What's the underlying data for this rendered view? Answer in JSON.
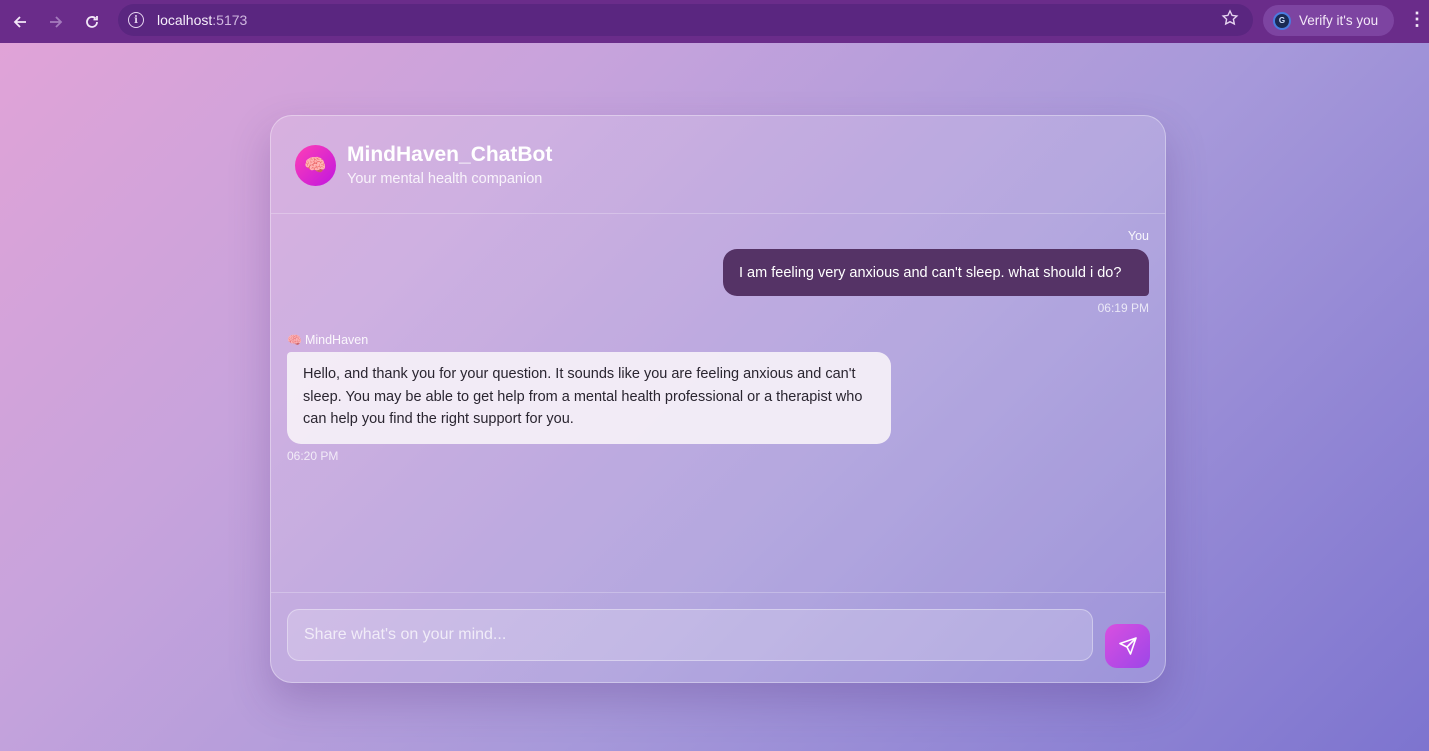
{
  "browser": {
    "url_host": "localhost",
    "url_port": ":5173",
    "verify_label": "Verify it's you",
    "profile_initial": "G"
  },
  "header": {
    "title": "MindHaven_ChatBot",
    "subtitle": "Your mental health companion",
    "avatar_emoji": "🧠"
  },
  "messages": [
    {
      "sender": "You",
      "text": "I am feeling very anxious and can't sleep. what should i do?",
      "time": "06:19 PM"
    },
    {
      "sender": "MindHaven",
      "sender_emoji": "🧠",
      "text": "Hello, and thank you for your question. It sounds like you are feeling anxious and can't sleep. You may be able to get help from a mental health professional or a therapist who can help you find the right support for you.",
      "time": "06:20 PM"
    }
  ],
  "input": {
    "placeholder": "Share what's on your mind..."
  },
  "colors": {
    "user_bubble": "#553366",
    "send_button": "#c04be4",
    "avatar": "#e02ac8"
  }
}
